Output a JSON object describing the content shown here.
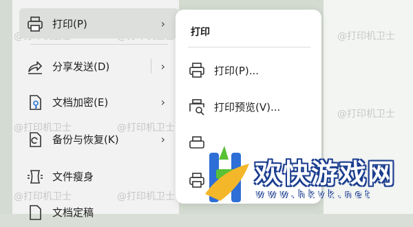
{
  "main_menu": {
    "items": [
      {
        "label": "打印(P)",
        "icon": "printer-icon",
        "has_submenu": true,
        "active": true
      },
      {
        "label": "分享发送(D)",
        "icon": "share-icon",
        "has_submenu": true
      },
      {
        "label": "文档加密(E)",
        "icon": "encrypt-doc-icon",
        "has_submenu": true
      },
      {
        "label": "备份与恢复(K)",
        "icon": "backup-icon",
        "has_submenu": true
      },
      {
        "label": "文件瘦身",
        "icon": "slim-file-icon",
        "has_submenu": false
      },
      {
        "label": "文档定稿",
        "icon": "finalize-doc-icon",
        "has_submenu": false
      }
    ],
    "chevron": "›"
  },
  "submenu": {
    "title": "打印",
    "items": [
      {
        "label": "打印(P)...",
        "icon": "printer-icon"
      },
      {
        "label": "打印预览(V)...",
        "icon": "print-preview-icon"
      },
      {
        "label": "",
        "icon": "batch-print-icon"
      },
      {
        "label": "",
        "icon": "print-setup-icon"
      }
    ]
  },
  "watermarks": [
    "@打印机卫士"
  ],
  "logo": {
    "text": "欢快游戏网",
    "url": "www.hkvk.net"
  },
  "colors": {
    "accent_blue": "#2d6fd6",
    "logo_green": "#58c135",
    "logo_yellow": "#f5b72a"
  }
}
